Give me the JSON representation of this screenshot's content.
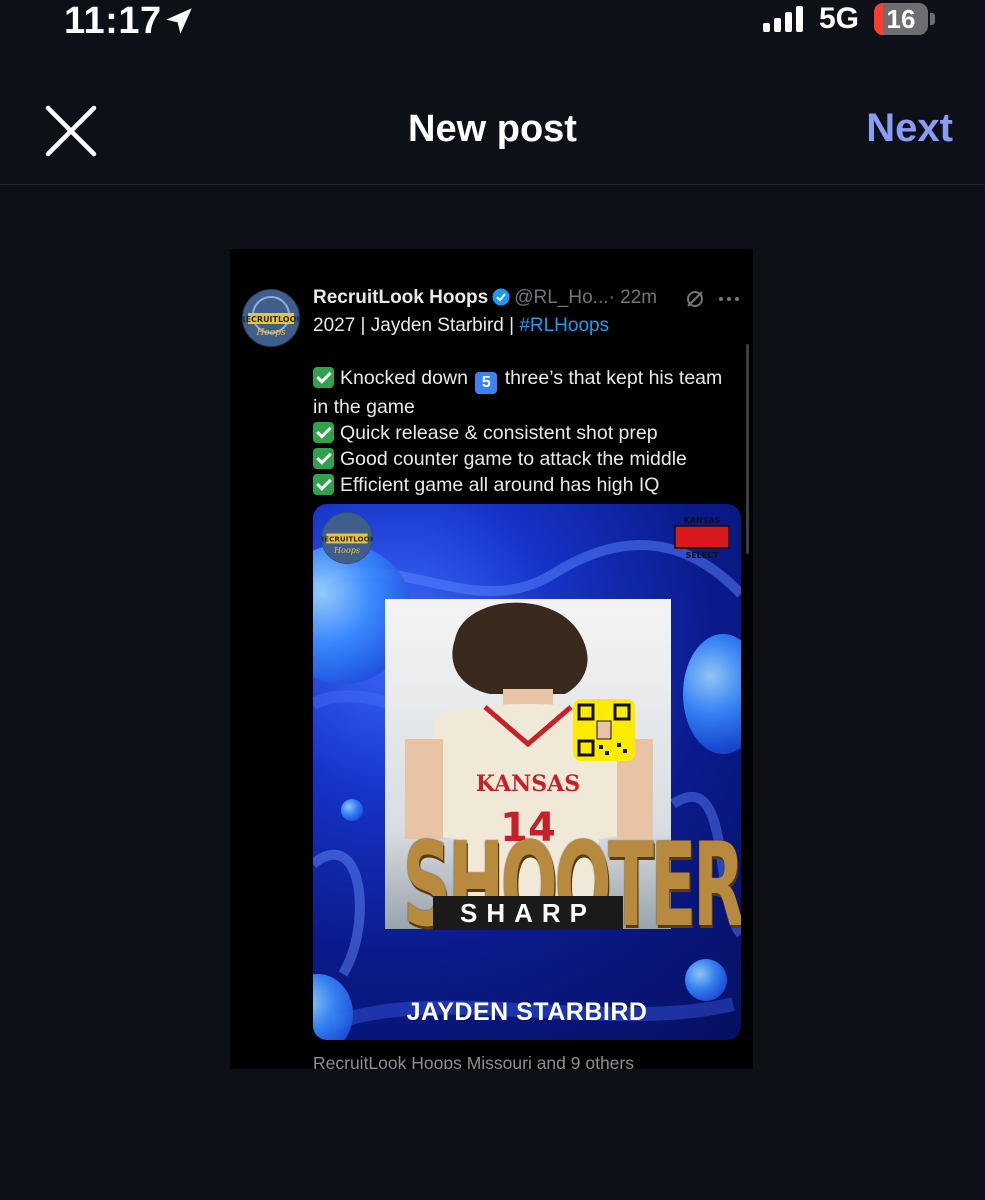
{
  "status_bar": {
    "time": "11:17",
    "network": "5G",
    "battery_level": "16",
    "battery_color": "#ff3b30",
    "icons": [
      "location-arrow-icon",
      "signal-bars-icon",
      "battery-icon"
    ]
  },
  "header": {
    "title": "New post",
    "next_label": "Next",
    "next_color": "#8a9cf3",
    "close_icon": "close-icon"
  },
  "post": {
    "author_name": "RecruitLook Hoops",
    "handle": "@RL_Ho...",
    "time_ago": "· 22m",
    "line1_prefix": "2027 | Jayden Starbird | ",
    "hashtag": "#RLHoops",
    "hashtag_color": "#1d9bf0",
    "bullets": [
      {
        "pre": "Knocked down ",
        "keycap": "5",
        "post": " three’s that kept his team in the game"
      },
      {
        "pre": "Quick release & consistent shot prep"
      },
      {
        "pre": "Good counter game to attack the middle"
      },
      {
        "pre": "Efficient game all around has high IQ"
      }
    ],
    "card": {
      "logo_text": "RECRUITLOOK Hoops",
      "badge_text": "KANSAS SELECT",
      "jersey_text": "KANSAS",
      "jersey_number": "14",
      "headline": "SHOOTER",
      "subheadline": "SHARP",
      "player_name": "JAYDEN STARBIRD"
    },
    "footer": "RecruitLook Hoops Missouri and 9 others"
  }
}
